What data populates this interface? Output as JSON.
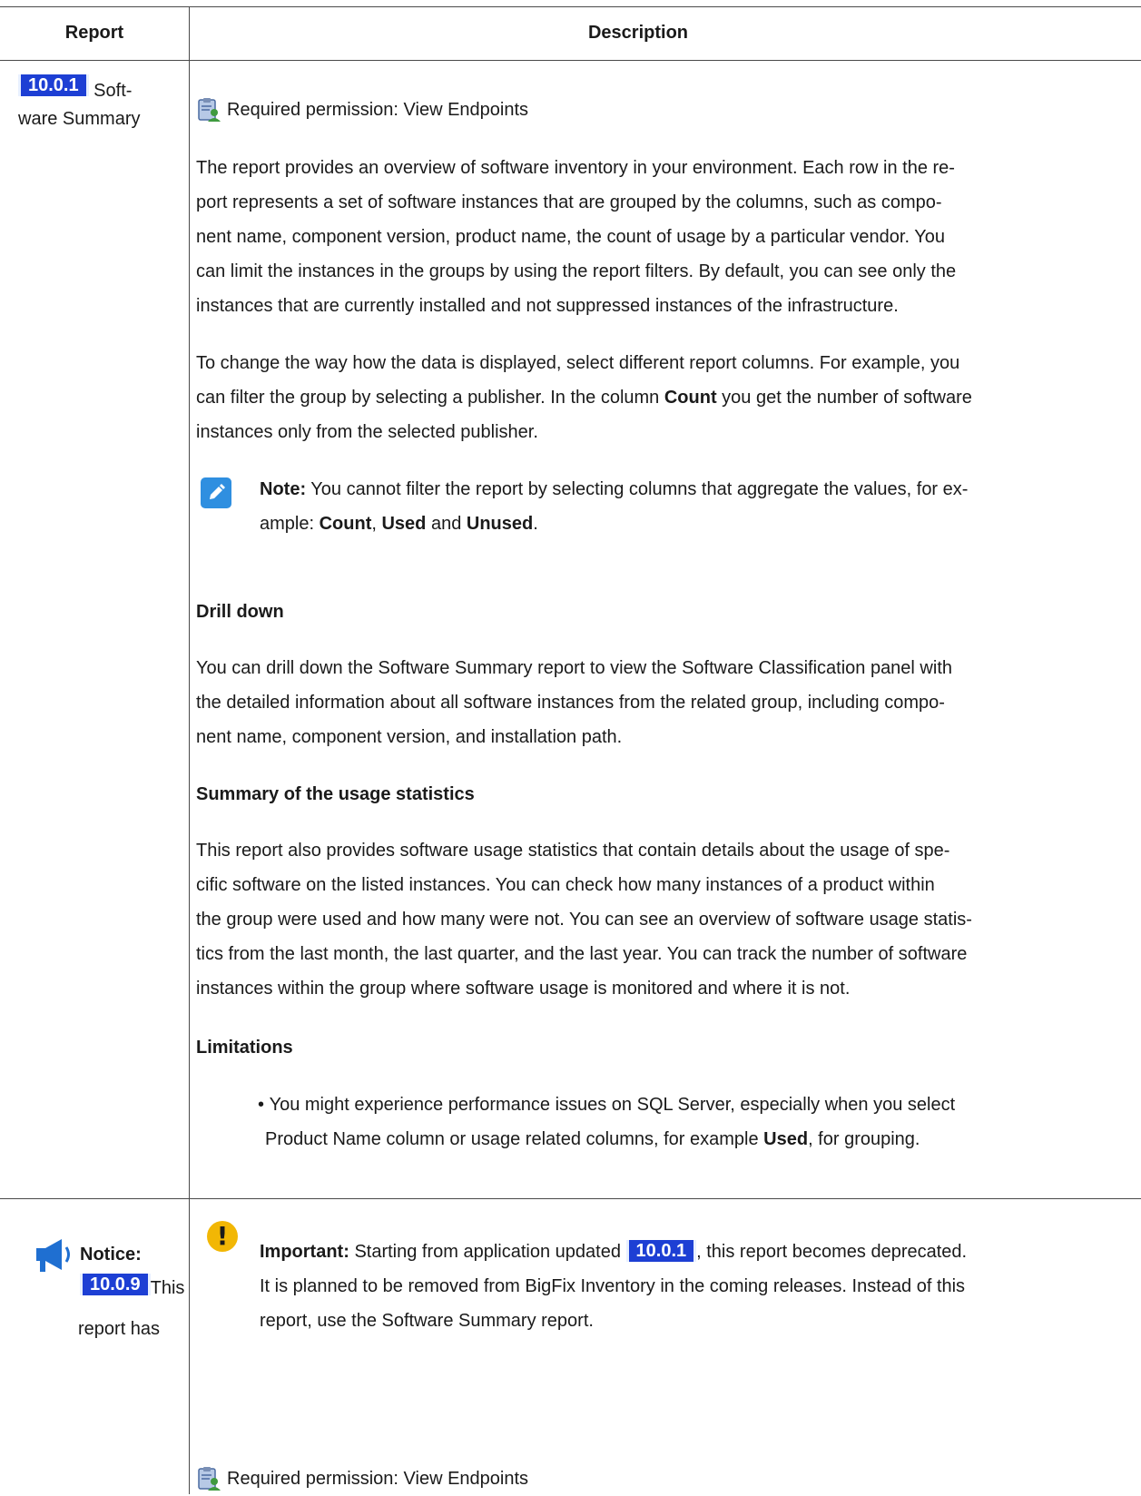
{
  "table": {
    "headers": {
      "report": "Report",
      "description": "Description"
    },
    "row1": {
      "version": "10.0.1",
      "report_name_line1": "Soft-",
      "report_name_line2": "ware Summary",
      "permission": "Required permission: View Endpoints",
      "para1": [
        "The report provides an overview of software inventory in your environment. Each row in the re-",
        "port represents a set of software instances that are grouped by the columns, such as compo-",
        "nent name, component version, product name, the count of usage by a particular vendor. You",
        "can limit the instances in the groups by using the report filters. By default, you can see only the",
        "instances that are currently installed and not suppressed instances of the infrastructure."
      ],
      "para2": {
        "line1": "To change the way how the data is displayed, select different report columns. For example, you",
        "line2_pre": "can filter the group by selecting a publisher. In the column ",
        "line2_bold": "Count",
        "line2_post": " you get the number of software",
        "line3": "instances only from the selected publisher."
      },
      "note": {
        "label": "Note:",
        "line1": " You cannot filter the report by selecting columns that aggregate the values, for ex-",
        "line2_pre": "ample: ",
        "count": "Count",
        "sep": ", ",
        "used": "Used",
        "and": " and ",
        "unused": "Unused",
        "end": "."
      },
      "drill_heading": "Drill down",
      "drill": [
        "You can drill down the Software Summary report to view the Software Classification panel with",
        "the detailed information about all software instances from the related group, including compo-",
        "nent name, component version, and installation path."
      ],
      "usage_heading": "Summary of the usage statistics",
      "usage": [
        "This report also provides software usage statistics that contain details about the usage of spe-",
        "cific software on the listed instances. You can check how many instances of a product within",
        "the group were used and how many were not. You can see an overview of software usage statis-",
        "tics from the last month, the last quarter, and the last year. You can track the number of software",
        "instances within the group where software usage is monitored and where it is not."
      ],
      "limitations_heading": "Limitations",
      "limitation": {
        "line1": "You might experience performance issues on SQL Server, especially when you select",
        "line2_pre": "Product Name column or usage related columns, for example ",
        "line2_bold": "Used",
        "line2_post": ", for grouping."
      }
    },
    "row2": {
      "notice_label": "Notice:",
      "version": "10.0.9",
      "notice_text1": "This",
      "notice_text2": "report has",
      "important_label": "Important:",
      "important_pre": " Starting from application updated ",
      "important_version": "10.0.1",
      "important_post": ", this report becomes deprecated.",
      "important_line2": "It is planned to be removed from BigFix Inventory in the coming releases. Instead of this",
      "important_line3": "report, use the Software Summary report.",
      "permission": "Required permission: View Endpoints"
    }
  }
}
